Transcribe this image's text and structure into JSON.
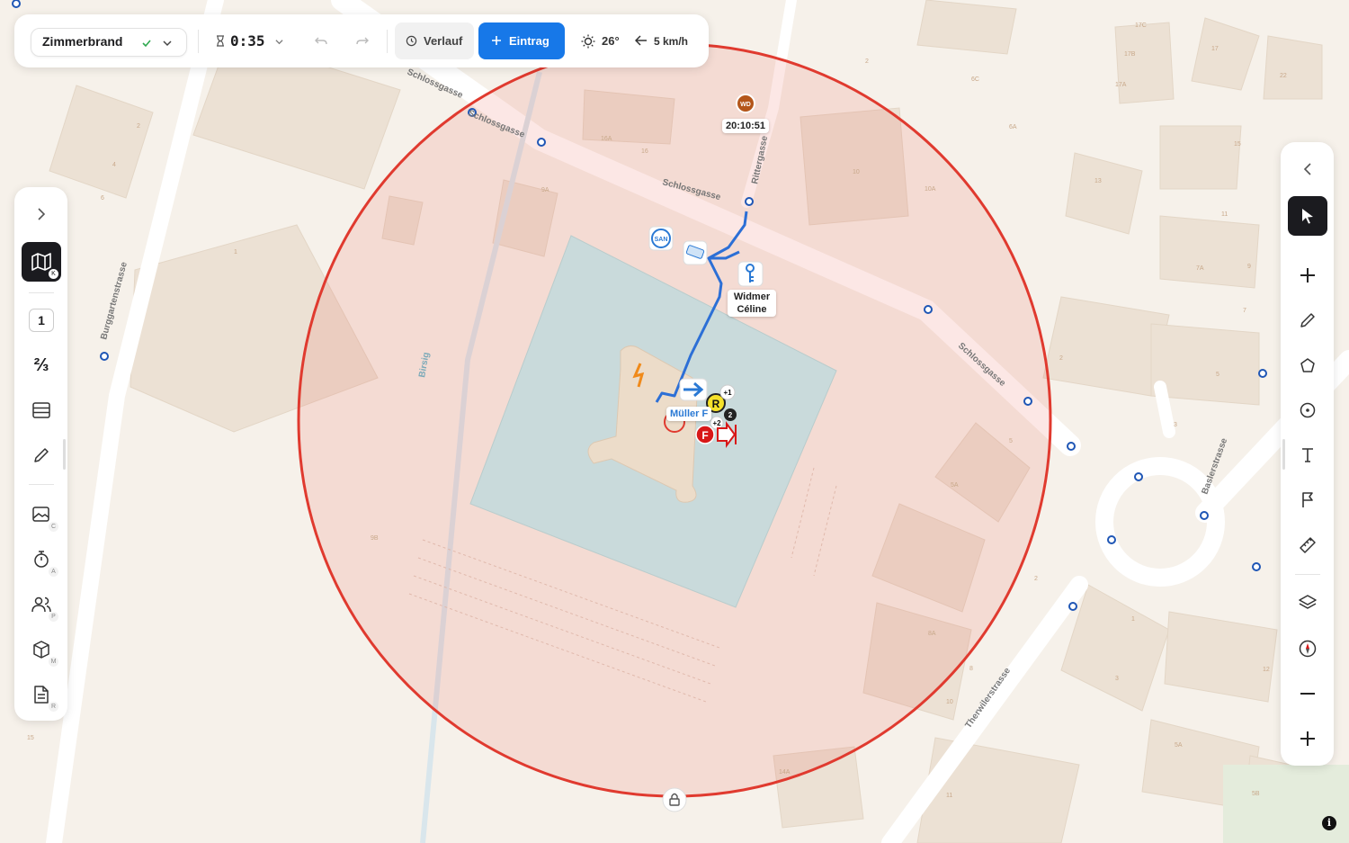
{
  "topbar": {
    "incident_name": "Zimmerbrand",
    "timer": "0:35",
    "history_label": "Verlauf",
    "entry_label": "Eintrag",
    "temperature": "26°",
    "wind": "5 km/h"
  },
  "leftbar": {
    "expand_icon": "chevron-right-icon",
    "items": [
      {
        "icon": "map-icon",
        "shortcut": "K",
        "active": true
      },
      {
        "icon": "one-icon",
        "label": "1"
      },
      {
        "icon": "fraction-icon",
        "label": "⅔"
      },
      {
        "icon": "table-icon"
      },
      {
        "icon": "pencil-icon"
      },
      {
        "icon": "image-icon",
        "shortcut": "C"
      },
      {
        "icon": "stopwatch-icon",
        "shortcut": "A"
      },
      {
        "icon": "people-icon",
        "shortcut": "P"
      },
      {
        "icon": "cube-icon",
        "shortcut": "M"
      },
      {
        "icon": "document-icon",
        "shortcut": "R"
      }
    ]
  },
  "rightbar": {
    "items": [
      "collapse-icon",
      "cursor-icon",
      "plus-icon",
      "pencil-icon",
      "polygon-icon",
      "circle-icon",
      "text-icon",
      "flag-icon",
      "ruler-icon",
      "layers-icon",
      "compass-icon",
      "zoom-out-icon",
      "zoom-in-icon"
    ]
  },
  "map": {
    "streets": [
      "Schlossgasse",
      "Schlossgasse",
      "Schlossgasse",
      "Schlossgasse",
      "Rittergasse",
      "Burggartenstrasse",
      "Baslerstrasse",
      "Therwilerstrasse",
      "Birsig"
    ],
    "markers": {
      "wd_badge": "WD",
      "wd_time": "20:10:51",
      "san_label": "SAN",
      "person_label": "Widmer Céline",
      "mueller_label": "Müller F",
      "r_label": "R",
      "f_label": "F",
      "count_2": "2",
      "plus_1": "+1",
      "plus_2": "+2"
    },
    "house_numbers": [
      "2",
      "4",
      "6",
      "1",
      "2",
      "16A",
      "16",
      "9A",
      "9B",
      "10",
      "10A",
      "17C",
      "17B",
      "17A",
      "17",
      "22",
      "6C",
      "6A",
      "13",
      "15",
      "11",
      "7A",
      "9",
      "7",
      "5",
      "3",
      "2",
      "5A",
      "5",
      "2",
      "1",
      "3",
      "12",
      "8A",
      "8",
      "10",
      "14A",
      "11",
      "5A",
      "5B",
      "15"
    ]
  },
  "colors": {
    "accent": "#1778e8",
    "radius": "#e03a2f"
  }
}
